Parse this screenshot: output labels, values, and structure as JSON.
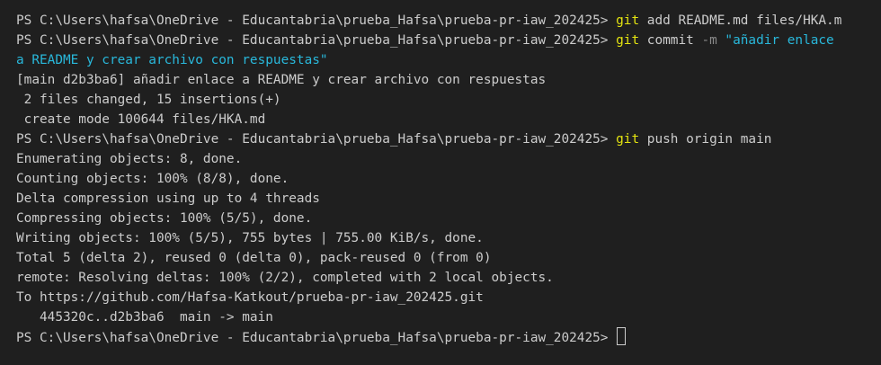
{
  "colors": {
    "background": "#1f1f1f",
    "text": "#cccccc",
    "command": "#e5e510",
    "flag": "#8a8a8a",
    "string": "#29b8db"
  },
  "terminal": {
    "lines": [
      {
        "prompt": "PS C:\\Users\\hafsa\\OneDrive - Educantabria\\prueba_Hafsa\\prueba-pr-iaw_202425> ",
        "cmd": "git",
        "args": " add README.md files/HKA.m"
      },
      {
        "prompt": "PS C:\\Users\\hafsa\\OneDrive - Educantabria\\prueba_Hafsa\\prueba-pr-iaw_202425> ",
        "cmd": "git",
        "args": " commit ",
        "flag": "-m",
        "str": " \"añadir enlace"
      },
      {
        "str": "a README y crear archivo con respuestas\""
      },
      {
        "text": "[main d2b3ba6] añadir enlace a README y crear archivo con respuestas"
      },
      {
        "text": " 2 files changed, 15 insertions(+)"
      },
      {
        "text": " create mode 100644 files/HKA.md"
      },
      {
        "prompt": "PS C:\\Users\\hafsa\\OneDrive - Educantabria\\prueba_Hafsa\\prueba-pr-iaw_202425> ",
        "cmd": "git",
        "args": " push origin main"
      },
      {
        "text": "Enumerating objects: 8, done."
      },
      {
        "text": "Counting objects: 100% (8/8), done."
      },
      {
        "text": "Delta compression using up to 4 threads"
      },
      {
        "text": "Compressing objects: 100% (5/5), done."
      },
      {
        "text": "Writing objects: 100% (5/5), 755 bytes | 755.00 KiB/s, done."
      },
      {
        "text": "Total 5 (delta 2), reused 0 (delta 0), pack-reused 0 (from 0)"
      },
      {
        "text": "remote: Resolving deltas: 100% (2/2), completed with 2 local objects."
      },
      {
        "text": "To https://github.com/Hafsa-Katkout/prueba-pr-iaw_202425.git"
      },
      {
        "text": "   445320c..d2b3ba6  main -> main"
      },
      {
        "prompt": "PS C:\\Users\\hafsa\\OneDrive - Educantabria\\prueba_Hafsa\\prueba-pr-iaw_202425> ",
        "cursor": true
      }
    ]
  }
}
